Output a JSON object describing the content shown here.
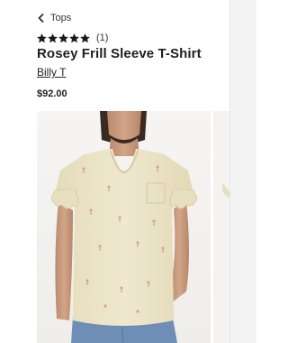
{
  "breadcrumb": {
    "label": "Tops",
    "icon": "chevron-left-icon"
  },
  "rating": {
    "stars": 5,
    "max_stars": 5,
    "count_text": "(1)",
    "icon": "star-icon",
    "star_color": "#1a1a1a"
  },
  "product": {
    "title": "Rosey Frill Sleeve T-Shirt",
    "brand": "Billy T",
    "price": "$92.00"
  },
  "image": {
    "subject": "model-wearing-cream-tshirt"
  },
  "colors": {
    "text": "#1f1f1f",
    "shirt": "#ebe3c4",
    "jeans": "#6f8eb5",
    "rosebud": "#e39aa2"
  }
}
